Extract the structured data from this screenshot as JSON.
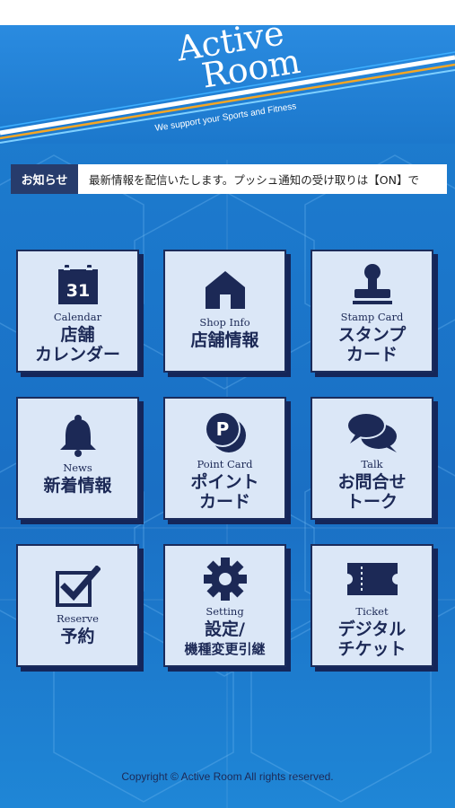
{
  "header": {
    "logo_line1": "Active",
    "logo_line2": "Room",
    "tagline": "We support your Sports and Fitness"
  },
  "news": {
    "label": "お知らせ",
    "text": "最新情報を配信いたします。プッシュ通知の受け取りは【ON】で"
  },
  "tiles": [
    {
      "en": "Calendar",
      "jp": "店舗\nカレンダー",
      "icon": "calendar-icon",
      "icon_text": "31"
    },
    {
      "en": "Shop Info",
      "jp": "店舗情報",
      "icon": "shop-icon"
    },
    {
      "en": "Stamp Card",
      "jp": "スタンプ\nカード",
      "icon": "stamp-icon"
    },
    {
      "en": "News",
      "jp": "新着情報",
      "icon": "bell-icon"
    },
    {
      "en": "Point Card",
      "jp": "ポイント\nカード",
      "icon": "point-coin-icon",
      "icon_text": "P"
    },
    {
      "en": "Talk",
      "jp": "お問合せ\nトーク",
      "icon": "chat-bubbles-icon"
    },
    {
      "en": "Reserve",
      "jp": "予約",
      "icon": "checkbox-icon"
    },
    {
      "en": "Setting",
      "jp1": "設定/",
      "jp2": "機種変更引継",
      "icon": "gear-icon"
    },
    {
      "en": "Ticket",
      "jp": "デジタル\nチケット",
      "icon": "ticket-icon"
    }
  ],
  "footer": {
    "copyright": "Copyright © Active Room All rights reserved."
  },
  "colors": {
    "navy": "#1c2956",
    "tile_bg": "#dbe7f7",
    "app_bg": "#1b77cb",
    "accent_orange": "#f5a623"
  }
}
